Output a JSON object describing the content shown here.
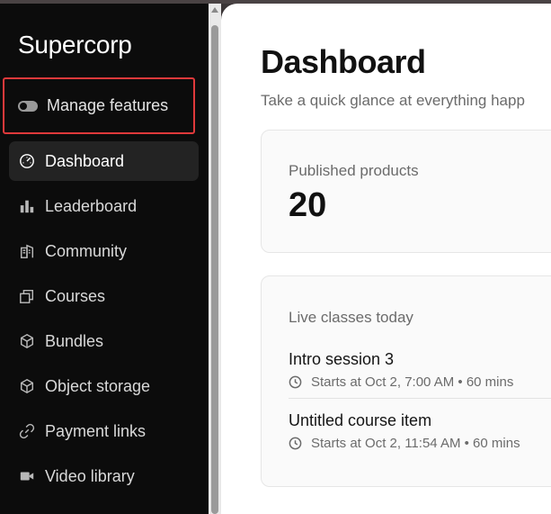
{
  "sidebar": {
    "brand": "Supercorp",
    "manage_features": "Manage features",
    "items": [
      {
        "label": "Dashboard",
        "icon": "gauge-icon",
        "active": true
      },
      {
        "label": "Leaderboard",
        "icon": "bar-chart-icon"
      },
      {
        "label": "Community",
        "icon": "building-icon"
      },
      {
        "label": "Courses",
        "icon": "copy-icon"
      },
      {
        "label": "Bundles",
        "icon": "boxes-icon"
      },
      {
        "label": "Object storage",
        "icon": "cube-icon"
      },
      {
        "label": "Payment links",
        "icon": "link-icon"
      },
      {
        "label": "Video library",
        "icon": "video-icon"
      }
    ]
  },
  "main": {
    "title": "Dashboard",
    "subtitle": "Take a quick glance at everything happ",
    "published": {
      "label": "Published products",
      "value": "20"
    },
    "live": {
      "label": "Live classes today",
      "classes": [
        {
          "title": "Intro session 3",
          "meta": "Starts at Oct 2, 7:00 AM • 60 mins"
        },
        {
          "title": "Untitled course item",
          "meta": "Starts at Oct 2, 11:54 AM • 60 mins"
        }
      ]
    }
  },
  "colors": {
    "sidebar_bg": "#0c0c0c",
    "active_item_bg": "#232323",
    "highlight_border": "#e0393b",
    "card_bg": "#fafafa"
  }
}
